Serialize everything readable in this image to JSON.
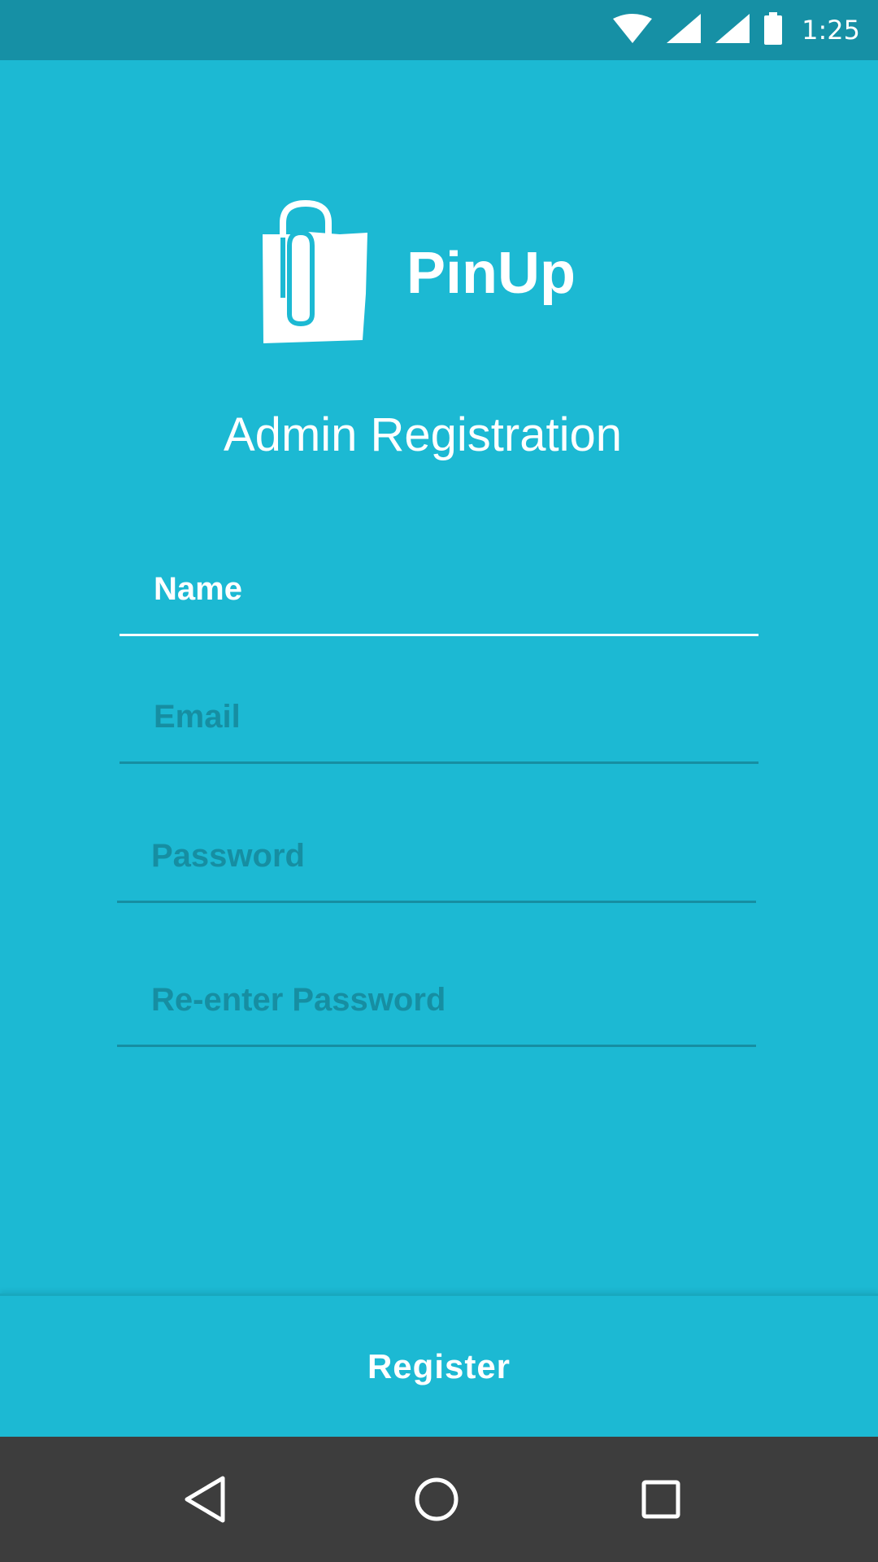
{
  "status_bar": {
    "time": "1:25",
    "icons": [
      "wifi-icon",
      "cell-signal-icon",
      "cell-signal-icon",
      "battery-icon"
    ]
  },
  "app": {
    "name": "PinUp",
    "logo": "shopping-bag-paperclip-icon"
  },
  "page": {
    "title": "Admin Registration"
  },
  "form": {
    "name": {
      "value": "Name",
      "focused": true
    },
    "email": {
      "placeholder": "Email"
    },
    "password": {
      "placeholder": "Password"
    },
    "confirm_password": {
      "placeholder": "Re-enter Password"
    }
  },
  "actions": {
    "register_label": "Register"
  },
  "nav_bar": {
    "items": [
      "back-icon",
      "home-icon",
      "recents-icon"
    ]
  },
  "colors": {
    "background": "#1cb9d3",
    "status_bar": "#1690a5",
    "field_line": "#168ea2",
    "nav_bar": "#3d3d3d",
    "text": "#ffffff"
  }
}
